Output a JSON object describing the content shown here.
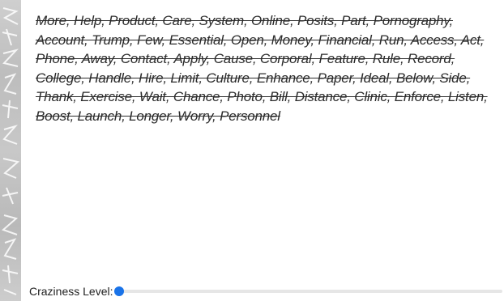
{
  "captcha": {
    "text": "More, Help, Product, Care, System, Online, Posits, Part, Pornography, Account, Trump, Few, Essential, Open, Money, Financial, Run, Access, Act, Phone, Away, Contact, Apply, Cause, Corporal, Feature, Rule, Record, College, Handle, Hire, Limit, Culture, Enhance, Paper, Ideal, Below, Side, Thank, Exercise, Wait, Chance, Photo, Bill, Distance, Clinic, Enforce, Listen, Boost, Launch, Longer, Worry, Personnel"
  },
  "controls": {
    "craziness_label": "Craziness Level:",
    "craziness_level": 0
  },
  "colors": {
    "accent": "#1a73e8",
    "text": "#2b2b2b",
    "strip": "#c4c4c4"
  }
}
